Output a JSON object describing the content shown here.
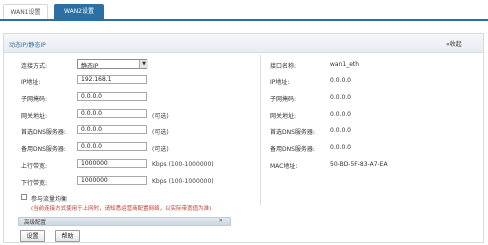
{
  "tabs": [
    {
      "label": "WAN1设置"
    },
    {
      "label": "WAN2设置"
    }
  ],
  "panel": {
    "title": "动态IP/静态IP",
    "collapse_label": "收起"
  },
  "left": {
    "connection_type": {
      "label": "连接方式:",
      "value": "静态IP"
    },
    "ip": {
      "label": "IP地址:",
      "value": "192.168.1"
    },
    "mask": {
      "label": "子网掩码:",
      "value": "0.0.0.0"
    },
    "gateway": {
      "label": "网关地址:",
      "value": "0.0.0.0",
      "hint": "(可选)"
    },
    "dns1": {
      "label": "首选DNS服务器:",
      "value": "0.0.0.0",
      "hint": "(可选)"
    },
    "dns2": {
      "label": "备用DNS服务器:",
      "value": "0.0.0.0",
      "hint": "(可选)"
    },
    "upload": {
      "label": "上行带宽:",
      "value": "1000000",
      "hint": "Kbps (100-1000000)"
    },
    "download": {
      "label": "下行带宽:",
      "value": "1000000",
      "hint": "Kbps (100-1000000)"
    },
    "balance": {
      "label": "参与流量均衡",
      "checked": false
    },
    "note": "(当前连接方式使用于上网时，请知悉运营商配置网络，以实际带宽值为准)",
    "advanced": "高级配置"
  },
  "right": {
    "iface": {
      "label": "接口名称:",
      "value": "wan1_eth"
    },
    "ip": {
      "label": "IP地址:",
      "value": "0.0.0.0"
    },
    "mask": {
      "label": "子网掩码:",
      "value": "0.0.0.0"
    },
    "gateway": {
      "label": "网关地址:",
      "value": "0.0.0.0"
    },
    "dns1": {
      "label": "首选DNS服务器:",
      "value": "0.0.0.0"
    },
    "dns2": {
      "label": "备用DNS服务器:",
      "value": "0.0.0.0"
    },
    "mac": {
      "label": "MAC地址:",
      "value": "50-BD-5F-83-A7-EA"
    }
  },
  "buttons": {
    "save": "设置",
    "help": "帮助"
  },
  "colors": {
    "accent": "#2b6fa4",
    "title": "#3a6fa0"
  }
}
